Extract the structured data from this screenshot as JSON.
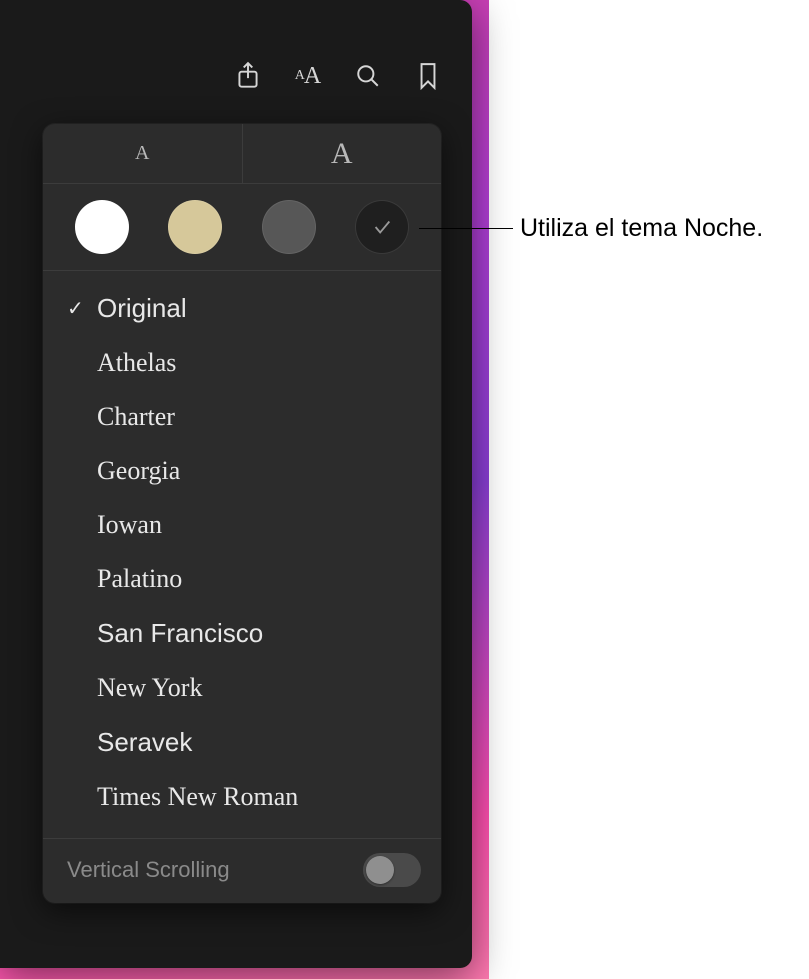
{
  "toolbar": {
    "share": "share-icon",
    "appearance": "text-appearance-icon",
    "search": "search-icon",
    "bookmark": "bookmark-icon"
  },
  "size_controls": {
    "small_glyph": "A",
    "large_glyph": "A"
  },
  "themes": {
    "white": {
      "color": "#ffffff"
    },
    "sepia": {
      "color": "#d6c89a"
    },
    "gray": {
      "color": "#575757"
    },
    "night": {
      "color": "#1f1f1f",
      "selected": true
    }
  },
  "fonts": [
    {
      "label": "Original",
      "css": "f-original",
      "selected": true
    },
    {
      "label": "Athelas",
      "css": "f-athelas"
    },
    {
      "label": "Charter",
      "css": "f-charter"
    },
    {
      "label": "Georgia",
      "css": "f-georgia"
    },
    {
      "label": "Iowan",
      "css": "f-iowan"
    },
    {
      "label": "Palatino",
      "css": "f-palatino"
    },
    {
      "label": "San Francisco",
      "css": "f-sf"
    },
    {
      "label": "New York",
      "css": "f-ny"
    },
    {
      "label": "Seravek",
      "css": "f-seravek"
    },
    {
      "label": "Times New Roman",
      "css": "f-tnr"
    }
  ],
  "footer": {
    "vertical_scrolling_label": "Vertical Scrolling",
    "vertical_scrolling_on": false
  },
  "callout": {
    "text": "Utiliza el tema Noche."
  }
}
